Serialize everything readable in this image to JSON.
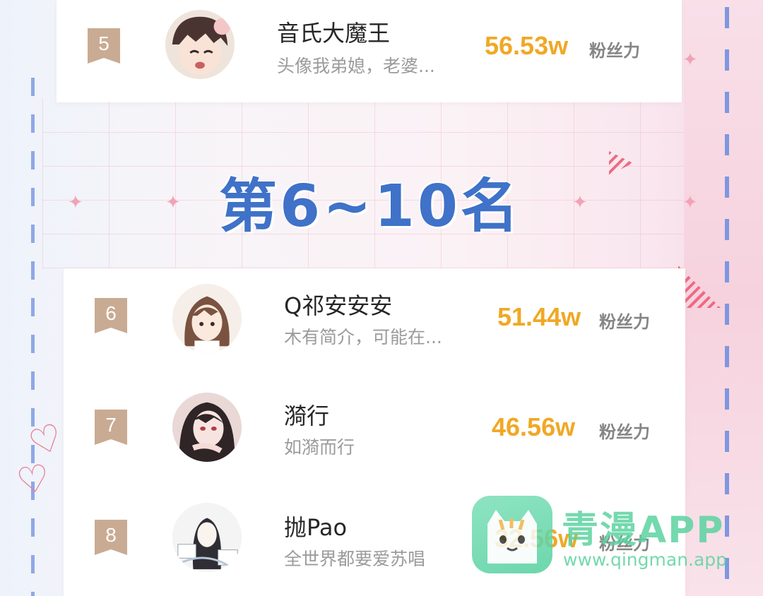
{
  "section": {
    "title": "第6~10名"
  },
  "fans_label": "粉丝力",
  "entries": [
    {
      "rank": "5",
      "name": "音氏大魔王",
      "bio": "头像我弟媳，老婆...",
      "fans": "56.53w",
      "avatar": "anime-boy-avatar"
    },
    {
      "rank": "6",
      "name": "Q祁安安安",
      "bio": "木有简介，可能在...",
      "fans": "51.44w",
      "avatar": "anime-long-hair-avatar"
    },
    {
      "rank": "7",
      "name": "漪行",
      "bio": "如漪而行",
      "fans": "46.56w",
      "avatar": "anime-dark-hair-avatar"
    },
    {
      "rank": "8",
      "name": "抛Pao",
      "bio": "全世界都要爱苏唱",
      "fans": "32.56w",
      "avatar": "anime-sketch-avatar"
    }
  ],
  "watermark": {
    "title": "青漫APP",
    "url": "www.qingman.app",
    "icon": "cat-icon"
  },
  "colors": {
    "fans_accent": "#f0a825",
    "title_blue": "#3f72c8",
    "badge": "#c9ab93",
    "watermark_green": "#5cd2a0"
  }
}
